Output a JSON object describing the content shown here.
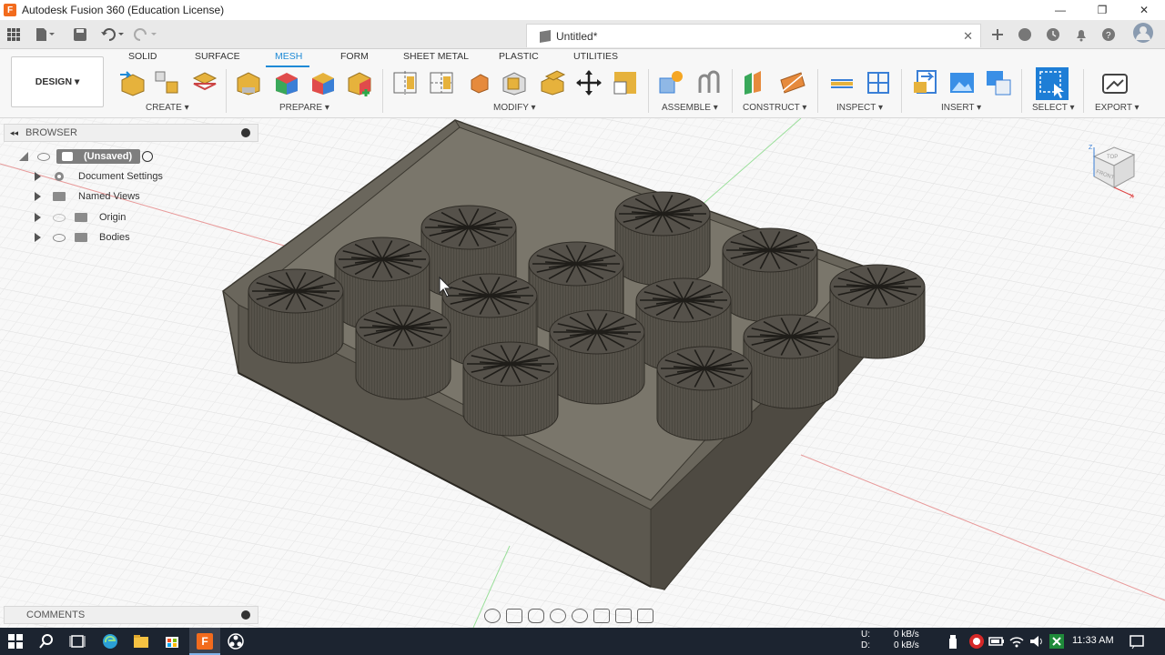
{
  "title_bar": {
    "app_title": "Autodesk Fusion 360 (Education License)"
  },
  "document": {
    "tab_title": "Untitled*"
  },
  "ribbon": {
    "workspace": "DESIGN ▾",
    "tabs": [
      "SOLID",
      "SURFACE",
      "MESH",
      "FORM",
      "SHEET METAL",
      "PLASTIC",
      "UTILITIES"
    ],
    "active_tab": "MESH",
    "groups": [
      "CREATE ▾",
      "PREPARE ▾",
      "MODIFY ▾",
      "ASSEMBLE ▾",
      "CONSTRUCT ▾",
      "INSPECT ▾",
      "INSERT ▾",
      "SELECT ▾",
      "EXPORT ▾"
    ]
  },
  "browser": {
    "title": "BROWSER",
    "root": "(Unsaved)",
    "items": [
      "Document Settings",
      "Named Views",
      "Origin",
      "Bodies"
    ]
  },
  "comments": {
    "title": "COMMENTS"
  },
  "taskbar": {
    "net_up_label": "U:",
    "net_down_label": "D:",
    "net_up": "0 kB/s",
    "net_down": "0 kB/s",
    "time": "11:33 AM"
  },
  "viewcube": {
    "top": "TOP",
    "front": "FRONT",
    "z": "Z",
    "x": "X"
  },
  "colors": {
    "accent": "#1e8ad6",
    "model": "#5f5b52",
    "taskbar": "#1c2430"
  }
}
